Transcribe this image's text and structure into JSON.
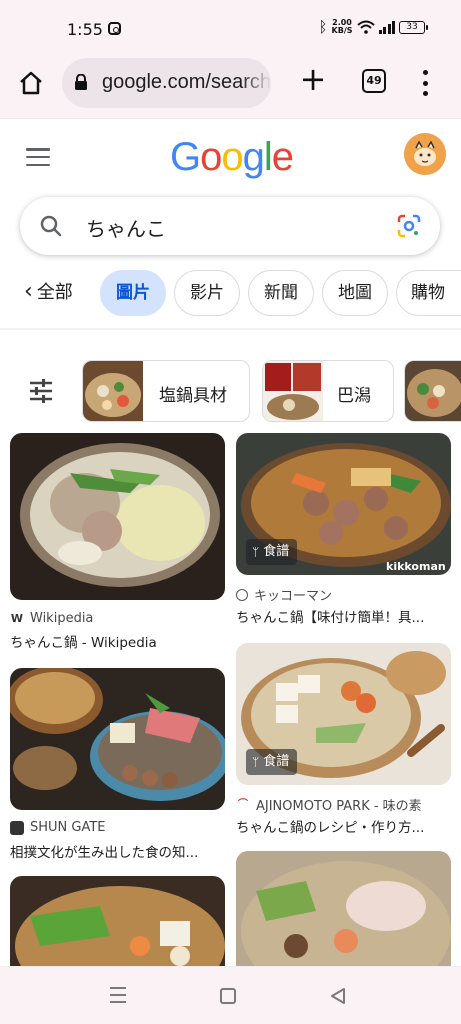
{
  "status_bar": {
    "time": "1:55",
    "net_speed_value": "2.00",
    "net_speed_unit": "KB/S",
    "battery": "33"
  },
  "browser": {
    "url": "google.com/search",
    "tab_count": "49"
  },
  "google": {
    "logo_letters": [
      "G",
      "o",
      "o",
      "g",
      "l",
      "e"
    ],
    "logo_colors": [
      "#4285F4",
      "#EA4335",
      "#FBBC05",
      "#4285F4",
      "#34A853",
      "#EA4335"
    ]
  },
  "search": {
    "query": "ちゃんこ"
  },
  "tabs": {
    "back_label": "全部",
    "items": [
      "圖片",
      "影片",
      "新聞",
      "地圖",
      "購物"
    ],
    "active": "圖片"
  },
  "filters": {
    "chips": [
      "塩鍋具材",
      "巴潟"
    ]
  },
  "results": [
    {
      "source": "Wikipedia",
      "title": "ちゃんこ鍋 - Wikipedia",
      "badge": ""
    },
    {
      "source": "キッコーマン",
      "title": "ちゃんこ鍋【味付け簡単！具...",
      "badge": "食譜"
    },
    {
      "source": "SHUN GATE",
      "title": "相撲文化が生み出した食の知...",
      "badge": ""
    },
    {
      "source": "AJINOMOTO PARK - 味の素",
      "title": "ちゃんこ鍋のレシピ・作り方...",
      "badge": "食譜"
    }
  ],
  "colors": {
    "chrome_bg": "#fbf2f6",
    "active_tab_bg": "#d3e3fd",
    "active_tab_text": "#0b57d0"
  }
}
